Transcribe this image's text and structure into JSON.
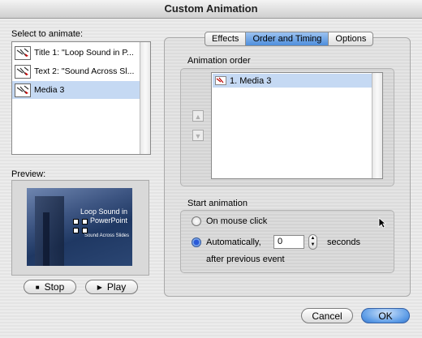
{
  "window": {
    "title": "Custom Animation"
  },
  "left": {
    "select_label": "Select to animate:",
    "items": [
      {
        "label": "Title 1: \"Loop Sound in P...",
        "selected": false
      },
      {
        "label": "Text 2: \"Sound Across Sl...",
        "selected": false
      },
      {
        "label": "Media 3",
        "selected": true
      }
    ],
    "preview_label": "Preview:",
    "preview": {
      "title": "Loop Sound in PowerPoint",
      "subtitle": "Sound Across Slides"
    },
    "stop_label": "Stop",
    "play_label": "Play"
  },
  "tabs": [
    {
      "label": "Effects",
      "active": false
    },
    {
      "label": "Order and Timing",
      "active": true
    },
    {
      "label": "Options",
      "active": false
    }
  ],
  "order": {
    "label": "Animation order",
    "items": [
      {
        "label": "1. Media 3",
        "selected": true
      }
    ]
  },
  "start": {
    "label": "Start animation",
    "on_click_label": "On mouse click",
    "auto_label": "Automatically,",
    "seconds_value": "0",
    "seconds_label": "seconds",
    "after_label": "after previous event",
    "selected": "auto"
  },
  "buttons": {
    "cancel": "Cancel",
    "ok": "OK"
  },
  "colors": {
    "accent": "#4f8fdd",
    "selection": "#c5d9f3"
  }
}
